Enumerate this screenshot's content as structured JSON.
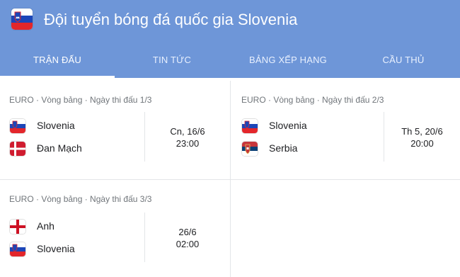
{
  "header": {
    "title": "Đội tuyển bóng đá quốc gia Slovenia",
    "flag_icon": "slovenia-flag-icon"
  },
  "tabs": [
    {
      "label": "TRẬN ĐẤU",
      "active": true
    },
    {
      "label": "TIN TỨC",
      "active": false
    },
    {
      "label": "BẢNG XẾP HẠNG",
      "active": false
    },
    {
      "label": "CẦU THỦ",
      "active": false
    }
  ],
  "matches": [
    {
      "meta": "EURO · Vòng bảng · Ngày thi đấu 1/3",
      "teams": [
        {
          "name": "Slovenia",
          "flag": "slovenia-flag-icon"
        },
        {
          "name": "Đan Mạch",
          "flag": "denmark-flag-icon"
        }
      ],
      "date": "Cn, 16/6",
      "time": "23:00"
    },
    {
      "meta": "EURO · Vòng bảng · Ngày thi đấu 2/3",
      "teams": [
        {
          "name": "Slovenia",
          "flag": "slovenia-flag-icon"
        },
        {
          "name": "Serbia",
          "flag": "serbia-flag-icon"
        }
      ],
      "date": "Th 5, 20/6",
      "time": "20:00"
    },
    {
      "meta": "EURO · Vòng bảng · Ngày thi đấu 3/3",
      "teams": [
        {
          "name": "Anh",
          "flag": "england-flag-icon"
        },
        {
          "name": "Slovenia",
          "flag": "slovenia-flag-icon"
        }
      ],
      "date": "26/6",
      "time": "02:00"
    }
  ],
  "colors": {
    "header_bg": "#6e96d8",
    "divider": "#e3e5e8",
    "meta_text": "#70757a"
  }
}
